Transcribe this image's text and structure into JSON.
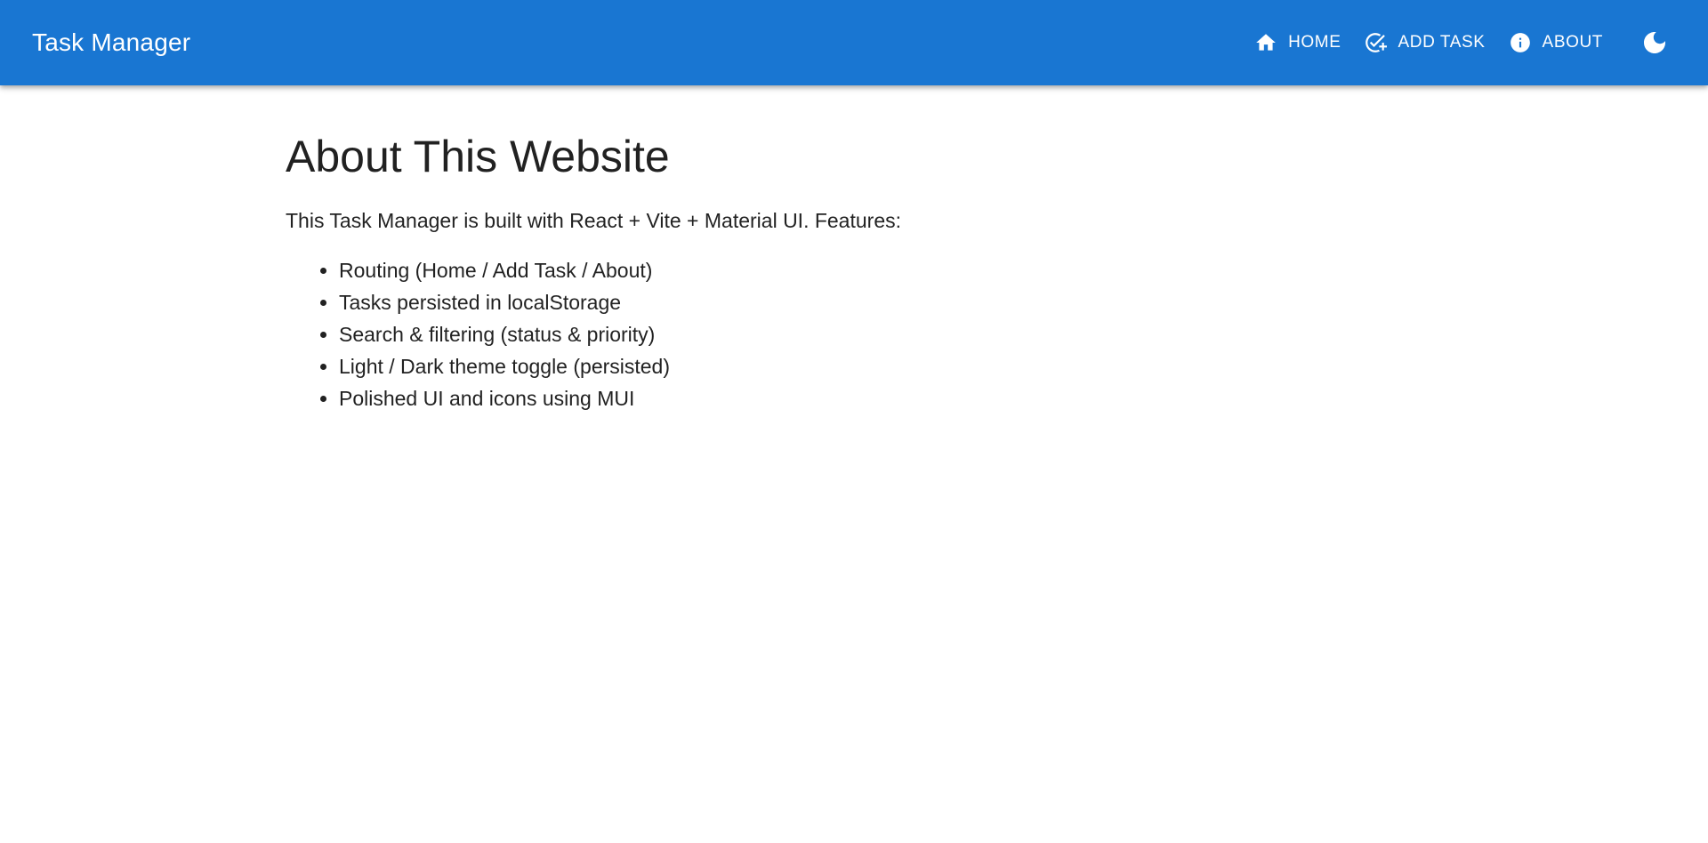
{
  "appbar": {
    "brand": "Task Manager",
    "nav": [
      {
        "label": "HOME",
        "icon": "home-icon"
      },
      {
        "label": "ADD TASK",
        "icon": "add-task-icon"
      },
      {
        "label": "ABOUT",
        "icon": "info-icon"
      }
    ],
    "theme_toggle_icon": "moon-icon",
    "color": "#1976d2"
  },
  "main": {
    "title": "About This Website",
    "intro": "This Task Manager is built with React + Vite + Material UI. Features:",
    "features": [
      "Routing (Home / Add Task / About)",
      "Tasks persisted in localStorage",
      "Search & filtering (status & priority)",
      "Light / Dark theme toggle (persisted)",
      "Polished UI and icons using MUI"
    ]
  }
}
